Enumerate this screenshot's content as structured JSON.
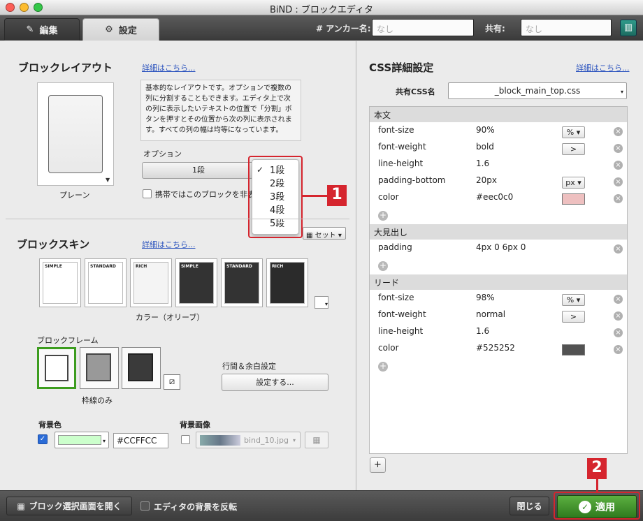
{
  "window": {
    "title": "BiND : ブロックエディタ"
  },
  "toolbar": {
    "tab_edit": "編集",
    "tab_settings": "設定",
    "anchor_label": "# アンカー名:",
    "anchor_placeholder": "なし",
    "share_label": "共有:",
    "share_value": "なし"
  },
  "block_layout": {
    "title": "ブロックレイアウト",
    "detail_link": "詳細はこちら...",
    "description": "基本的なレイアウトです。オプションで複数の列に分割することもできます。エディタ上で次の列に表示したいテキストの位置で「分割」ボタンを押すとその位置から次の列に表示されます。すべての列の幅は均等になっています。",
    "preview_label": "プレーン",
    "option_label": "オプション",
    "option_selected": "1段",
    "mobile_checkbox_label": "携帯ではこのブロックを非表示",
    "dropdown_options": [
      "1段",
      "2段",
      "3段",
      "4段",
      "5段"
    ],
    "dropdown_checked": "1段"
  },
  "block_skin": {
    "title": "ブロックスキン",
    "detail_link": "詳細はこちら...",
    "set_button": "セット",
    "skin_caption": "カラー（オリーブ）",
    "skins": [
      "SIMPLE",
      "STANDARD",
      "RICH",
      "SIMPLE",
      "STANDARD",
      "RICH"
    ],
    "frame_title": "ブロックフレーム",
    "frame_caption": "枠線のみ",
    "spacing_title": "行間＆余白設定",
    "spacing_button": "設定する...",
    "bg_color_label": "背景色",
    "bg_color_value": "#CCFFCC",
    "bg_color_swatch": "#ccffcc",
    "bg_image_label": "背景画像",
    "bg_image_file": "bind_10.jpg"
  },
  "css": {
    "title": "CSS詳細設定",
    "detail_link": "詳細はこちら...",
    "shared_label": "共有CSS名",
    "shared_value": "_block_main_top.css",
    "groups": [
      {
        "name": "本文",
        "rows": [
          {
            "prop": "font-size",
            "value": "90%",
            "unit": "%"
          },
          {
            "prop": "font-weight",
            "value": "bold",
            "unit": ">"
          },
          {
            "prop": "line-height",
            "value": "1.6",
            "unit": ""
          },
          {
            "prop": "padding-bottom",
            "value": "20px",
            "unit": "px"
          },
          {
            "prop": "color",
            "value": "#eec0c0",
            "unit": "swatch"
          }
        ]
      },
      {
        "name": "大見出し",
        "rows": [
          {
            "prop": "padding",
            "value": "4px 0 6px 0",
            "unit": ""
          }
        ]
      },
      {
        "name": "リード",
        "rows": [
          {
            "prop": "font-size",
            "value": "98%",
            "unit": "%"
          },
          {
            "prop": "font-weight",
            "value": "normal",
            "unit": ">"
          },
          {
            "prop": "line-height",
            "value": "1.6",
            "unit": ""
          },
          {
            "prop": "color",
            "value": "#525252",
            "unit": "swatch"
          }
        ]
      }
    ]
  },
  "bottom": {
    "open_selector": "ブロック選択画面を開く",
    "invert_bg": "エディタの背景を反転",
    "close": "閉じる",
    "apply": "適用"
  },
  "annotations": {
    "badge1": "1",
    "badge2": "2"
  },
  "colors": {
    "accent_red": "#d5252e",
    "apply_green": "#3a8a2a"
  }
}
